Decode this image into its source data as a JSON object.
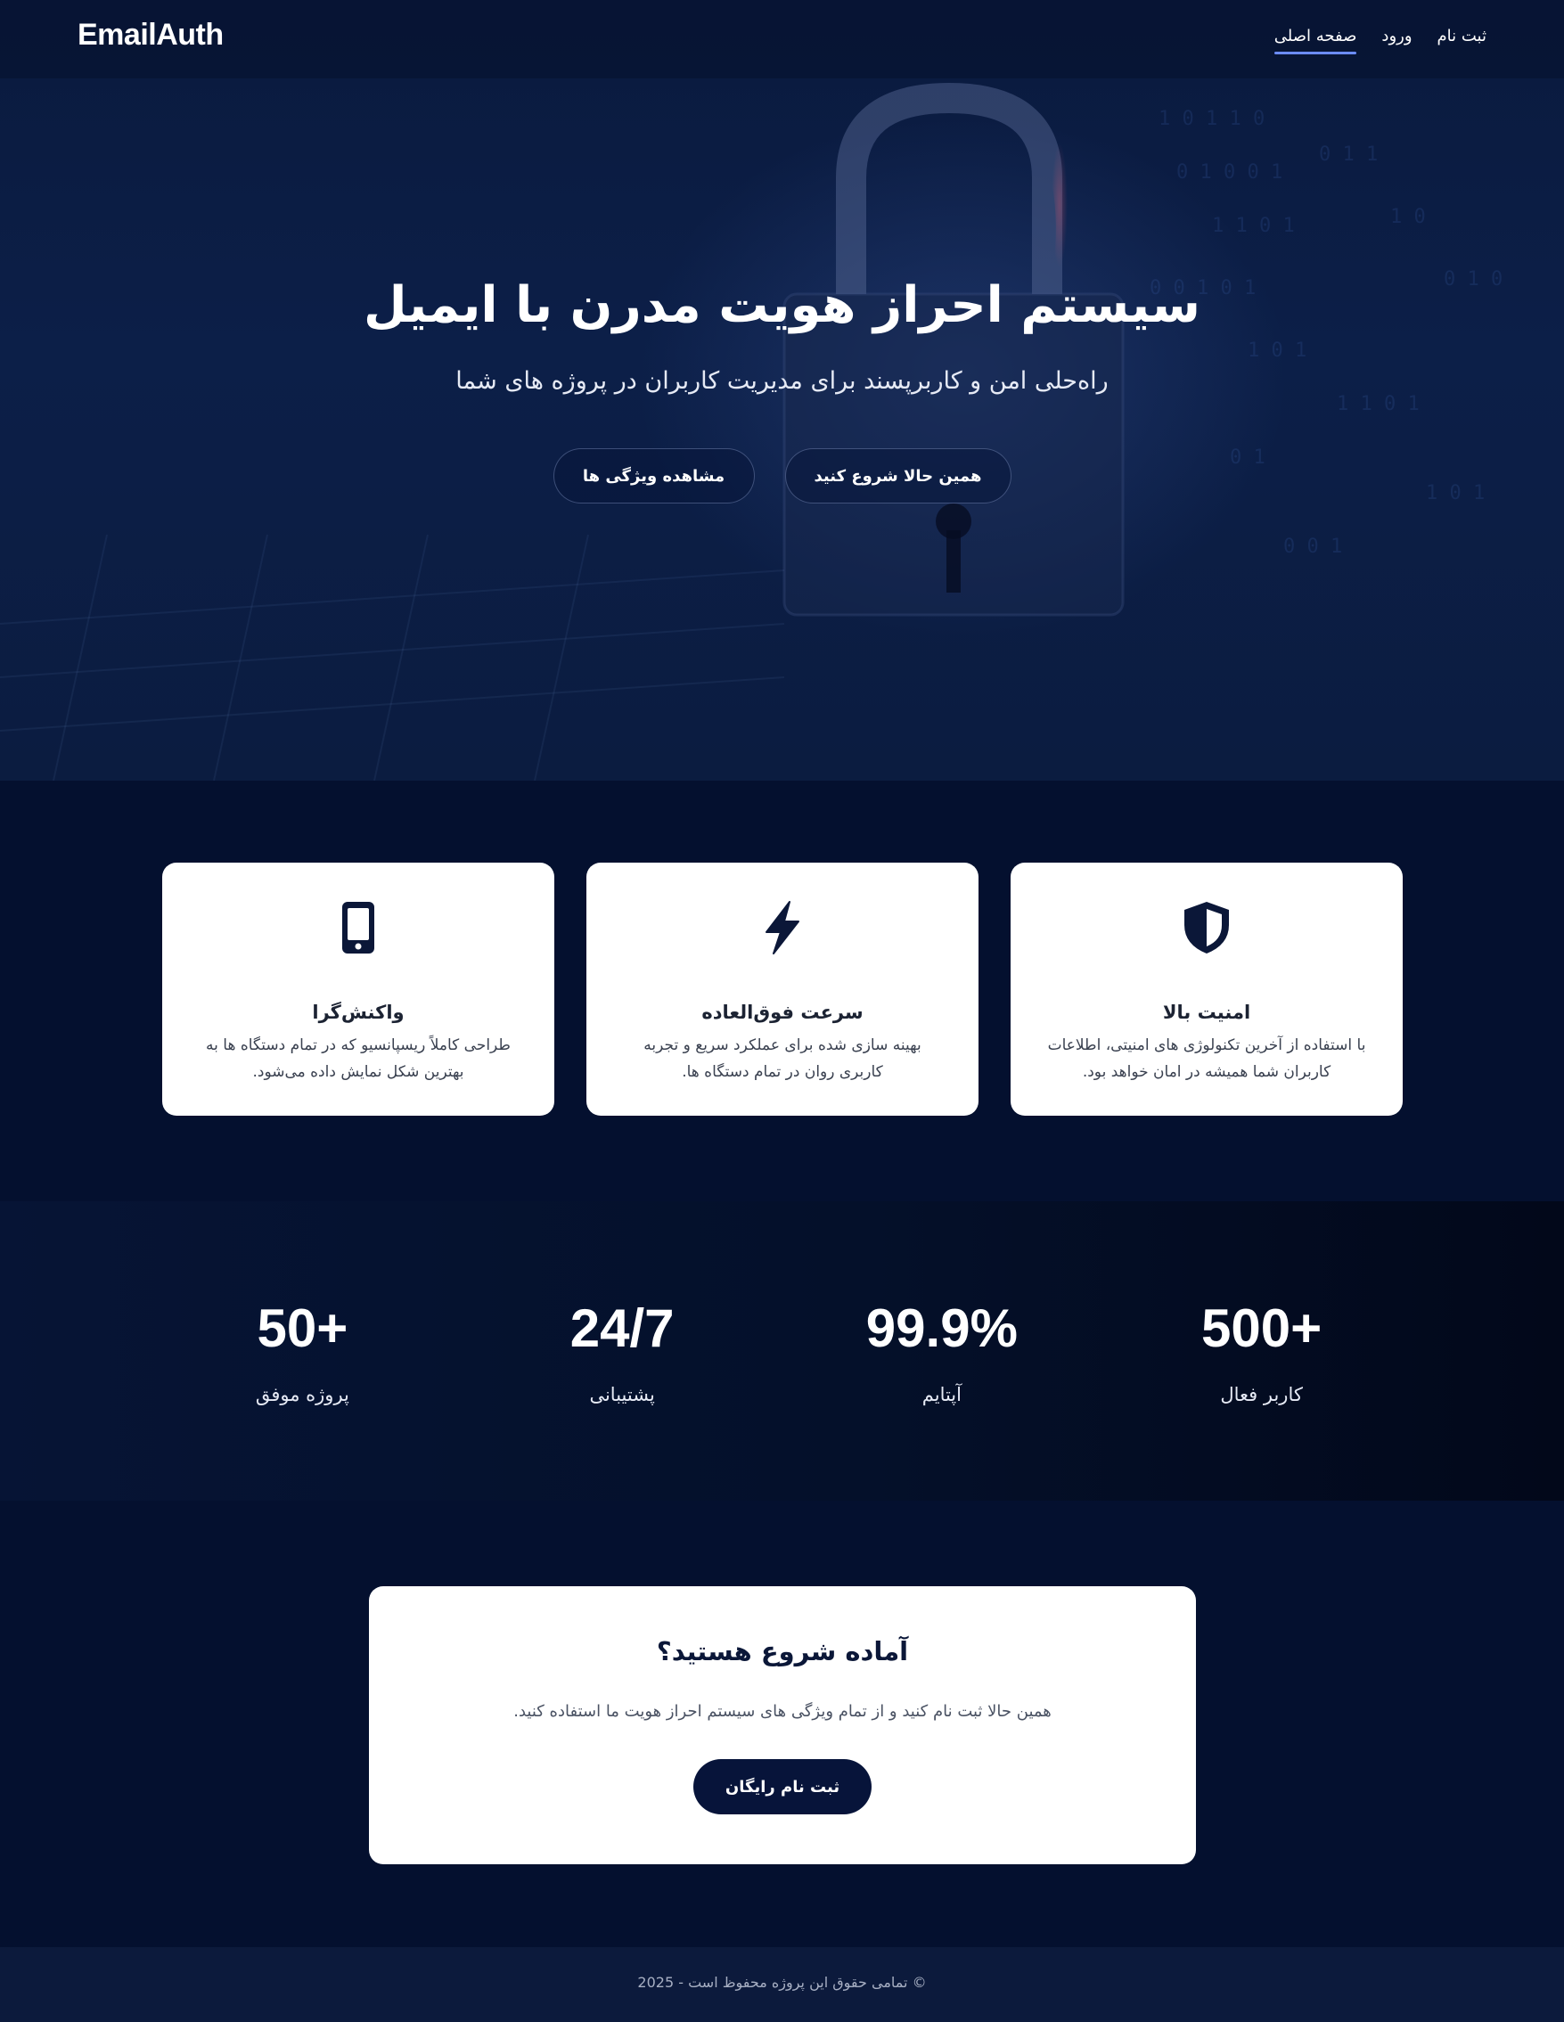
{
  "nav": {
    "logo": "EmailAuth",
    "links": [
      {
        "label": "صفحه اصلی",
        "active": true
      },
      {
        "label": "ورود",
        "active": false
      },
      {
        "label": "ثبت نام",
        "active": false
      }
    ]
  },
  "hero": {
    "title": "سیستم احراز هویت مدرن با ایمیل",
    "subtitle": "راه‌حلی امن و کاربرپسند برای مدیریت کاربران در پروژه های شما",
    "primary_button": "همین حالا شروع کنید",
    "secondary_button": "مشاهده ویژگی ها",
    "background_image": "padlock-security"
  },
  "features": [
    {
      "icon": "shield-icon",
      "title": "امنیت بالا",
      "description": "با استفاده از آخرین تکنولوژی های امنیتی، اطلاعات کاربران شما همیشه در امان خواهد بود."
    },
    {
      "icon": "lightning-icon",
      "title": "سرعت فوق‌العاده",
      "description": "بهینه سازی شده برای عملکرد سریع و تجربه کاربری روان در تمام دستگاه ها."
    },
    {
      "icon": "mobile-icon",
      "title": "واکنش‌گرا",
      "description": "طراحی کاملاً ریسپانسیو که در تمام دستگاه ها به بهترین شکل نمایش داده می‌شود."
    }
  ],
  "stats": [
    {
      "value": "500+",
      "label": "کاربر فعال"
    },
    {
      "value": "99.9%",
      "label": "آپتایم"
    },
    {
      "value": "24/7",
      "label": "پشتیبانی"
    },
    {
      "value": "50+",
      "label": "پروژه موفق"
    }
  ],
  "cta": {
    "title": "آماده شروع هستید؟",
    "text": "همین حالا ثبت نام کنید و از تمام ویژگی های سیستم احراز هویت ما استفاده کنید.",
    "button": "ثبت نام رایگان"
  },
  "footer": {
    "text": "© تمامی حقوق این پروژه محفوظ است - 2025"
  },
  "colors": {
    "background": "#04102f",
    "card": "#ffffff",
    "accent_underline": "#6b8cff",
    "dark_button": "#07143a"
  }
}
